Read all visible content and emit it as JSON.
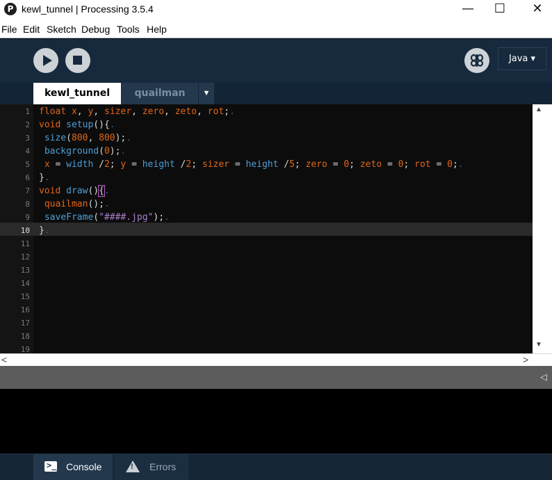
{
  "window": {
    "icon_glyph": "P",
    "title": "kewl_tunnel | Processing 3.5.4",
    "minimize_glyph": "—",
    "maximize_glyph": "☐",
    "close_glyph": "✕"
  },
  "menu": [
    "File",
    "Edit",
    "Sketch",
    "Debug",
    "Tools",
    "Help"
  ],
  "toolbar": {
    "mode": "Java ▾",
    "debug_icon": "butterfly-icon"
  },
  "tabs": {
    "active": "kewl_tunnel",
    "inactive": "quailman",
    "menu_glyph": "▼"
  },
  "editor": {
    "line_numbers": [
      "1",
      "2",
      "3",
      "4",
      "5",
      "6",
      "7",
      "8",
      "9",
      "10",
      "11",
      "12",
      "13",
      "14",
      "15",
      "16",
      "17",
      "18",
      "19"
    ],
    "current_line": "10",
    "lines": [
      "float x, y, sizer, zero, zeto, rot;",
      "void setup(){",
      " size(800, 800);",
      " background(0);",
      " x = width /2; y = height /2; sizer = height /5; zero = 0; zeto = 0; rot = 0;",
      "}",
      "void draw(){",
      " quailman();",
      " saveFrame(\"####.jpg\");",
      "}"
    ]
  },
  "scroll": {
    "up": "▲",
    "down": "▼",
    "left": "<",
    "right": ">"
  },
  "console": {
    "toggle_glyph": "◁"
  },
  "footer": {
    "console_label": "Console",
    "errors_label": "Errors"
  },
  "colors": {
    "toolbar_bg": "#172a3d",
    "editor_bg": "#0c0c0c",
    "keyword": "#e2661a",
    "function": "#006699"
  }
}
